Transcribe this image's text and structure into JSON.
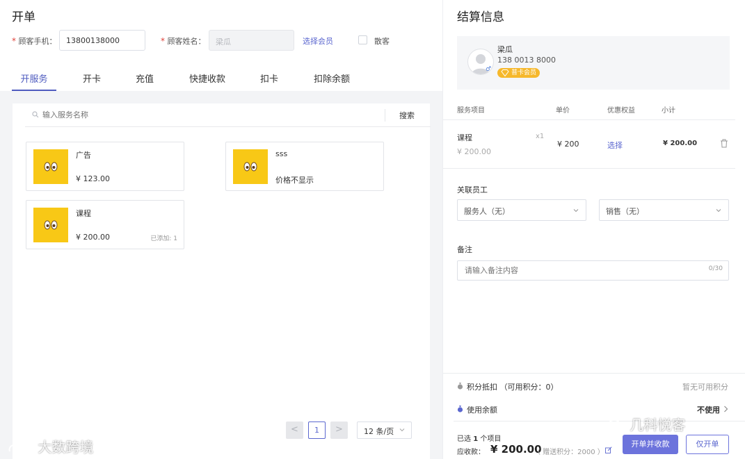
{
  "left": {
    "title": "开单",
    "phone_label": "顾客手机：",
    "phone_value": "13800138000",
    "name_label": "顾客姓名：",
    "name_placeholder": "梁瓜",
    "choose_member": "选择会员",
    "walkin_label": "散客",
    "tabs": [
      "开服务",
      "开卡",
      "充值",
      "快捷收款",
      "扣卡",
      "扣除余额"
    ],
    "active_tab": 0,
    "search_placeholder": "输入服务名称",
    "search_button": "搜索",
    "cards": [
      {
        "name": "广告",
        "price": "¥ 123.00",
        "added": ""
      },
      {
        "name": "sss",
        "price": "价格不显示",
        "added": ""
      },
      {
        "name": "课程",
        "price": "¥ 200.00",
        "added": "已添加: 1"
      }
    ],
    "pager": {
      "prev": "<",
      "page": "1",
      "next": ">",
      "size": "12 条/页"
    }
  },
  "right": {
    "title": "结算信息",
    "member": {
      "name": "梁瓜",
      "phone": "138 0013 8000",
      "badge": "普卡会员"
    },
    "headers": {
      "item": "服务项目",
      "price": "单价",
      "benefit": "优惠权益",
      "subtotal": "小计"
    },
    "line_item": {
      "name": "课程",
      "sub_price": "¥ 200.00",
      "qty": "x1",
      "price": "¥ 200",
      "choose": "选择",
      "subtotal": "¥ 200.00"
    },
    "staff_label": "关联员工",
    "server_select": "服务人（无）",
    "sales_select": "销售（无）",
    "note_label": "备注",
    "note_placeholder": "请输入备注内容",
    "note_count": "0/30",
    "points_label": "积分抵扣 （可用积分：0）",
    "points_none": "暂无可用积分",
    "balance_label": "使用余额",
    "balance_value": "不使用",
    "selected_prefix": "已选",
    "selected_count": "1",
    "selected_suffix": "个项目",
    "receivable_label": "应收款：",
    "receivable_value": "¥ 200.00",
    "gift_points": "（ 赠送积分：2000 ）",
    "btn_open_pay": "开单并收款",
    "btn_open_only": "仅开单"
  },
  "watermarks": {
    "left": "大数跨境",
    "right": "几科悦客"
  },
  "colors": {
    "accent": "#5b67cf",
    "primary_button": "#6c73dc",
    "thumb": "#f8c816",
    "badge": "#f6b82c"
  }
}
